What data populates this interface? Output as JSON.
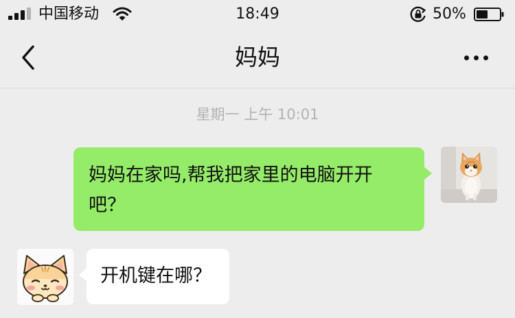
{
  "status_bar": {
    "carrier": "中国移动",
    "time": "18:49",
    "battery_percent": "50%",
    "battery_level": 0.5,
    "signal_bars": 3,
    "icons": [
      "signal-icon",
      "wifi-icon",
      "rotation-lock-icon",
      "battery-icon"
    ]
  },
  "nav": {
    "title": "妈妈",
    "back_icon": "chevron-left-icon",
    "more_icon": "more-dots-icon"
  },
  "chat": {
    "timestamp": "星期一 上午 10:01",
    "messages": [
      {
        "sender": "me",
        "text": "妈妈在家吗,帮我把家里的电脑开开吧？",
        "avatar": "kitten-photo"
      },
      {
        "sender": "mom",
        "text": "开机键在哪？",
        "avatar": "cartoon-cat"
      }
    ]
  },
  "colors": {
    "background": "#ededed",
    "sent_bubble": "#95ec69",
    "received_bubble": "#ffffff",
    "timestamp_text": "#b2b2b2"
  }
}
